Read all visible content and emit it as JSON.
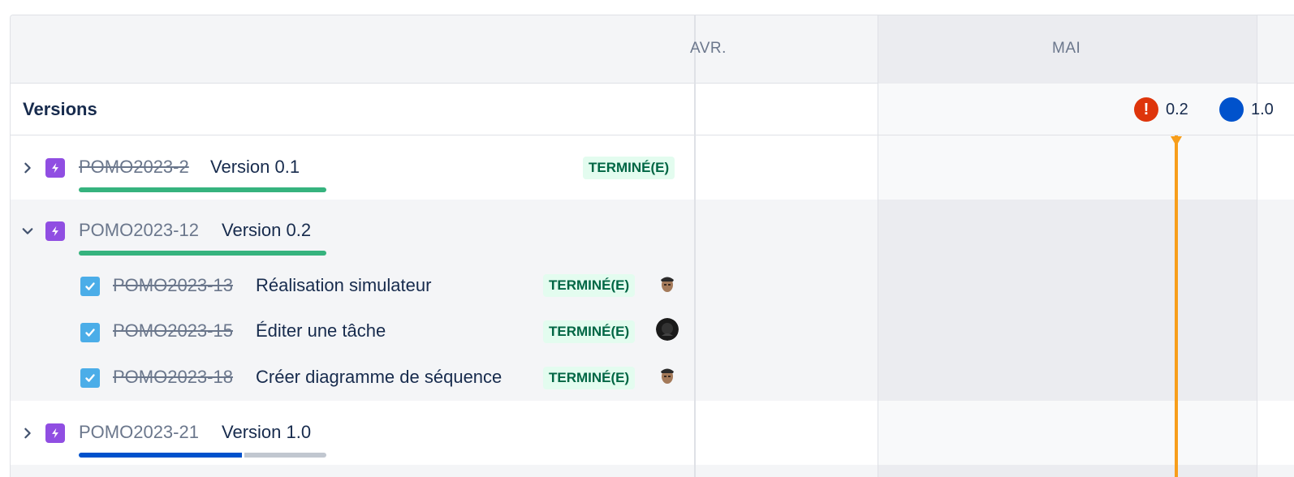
{
  "timeline": {
    "months": [
      "AVR.",
      "MAI"
    ],
    "version_markers": [
      {
        "label": "0.2",
        "status": "warning",
        "color": "#de350b"
      },
      {
        "label": "1.0",
        "status": "released",
        "color": "#0052cc"
      }
    ],
    "today_color": "#f79e1b"
  },
  "left_panel": {
    "versions_title": "Versions"
  },
  "rows": [
    {
      "key": "POMO2023-2",
      "summary": "Version 0.1",
      "status": "TERMINÉ(E)",
      "done": true,
      "expanded": false,
      "progress": {
        "done": 1.0,
        "in_progress": 0.0,
        "todo": 0.0
      }
    },
    {
      "key": "POMO2023-12",
      "summary": "Version 0.2",
      "status": "",
      "done": false,
      "expanded": true,
      "progress": {
        "done": 1.0,
        "in_progress": 0.0,
        "todo": 0.0
      },
      "children": [
        {
          "key": "POMO2023-13",
          "summary": "Réalisation simulateur",
          "status": "TERMINÉ(E)",
          "done": true
        },
        {
          "key": "POMO2023-15",
          "summary": "Éditer une tâche",
          "status": "TERMINÉ(E)",
          "done": true
        },
        {
          "key": "POMO2023-18",
          "summary": "Créer diagramme de séquence",
          "status": "TERMINÉ(E)",
          "done": true
        }
      ]
    },
    {
      "key": "POMO2023-21",
      "summary": "Version 1.0",
      "status": "",
      "done": false,
      "expanded": false,
      "progress": {
        "done": 0.0,
        "in_progress": 0.66,
        "todo": 0.34
      }
    }
  ],
  "colors": {
    "progress_done": "#36b37e",
    "progress_in_progress": "#0052cc",
    "progress_todo": "#c1c7d0",
    "epic": "#904ee2",
    "task": "#4bade8"
  }
}
